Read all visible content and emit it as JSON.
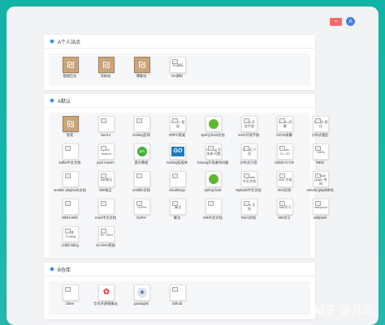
{
  "topbar": {
    "button_label": "▪",
    "avatar_letter": "A"
  },
  "sections": [
    {
      "title": "A个人站点",
      "items": [
        {
          "icon": "ru-icon",
          "label": "管理后台",
          "icon_text": ""
        },
        {
          "icon": "ru-icon",
          "label": "导航站",
          "icon_text": ""
        },
        {
          "icon": "ru-icon",
          "label": "博客站",
          "icon_text": ""
        },
        {
          "icon": "broken-image-icon",
          "label": "Go源码",
          "icon_text": "Go源码"
        }
      ]
    },
    {
      "title": "A默认",
      "items": [
        {
          "icon": "ru-icon",
          "label": "答案",
          "icon_text": ""
        },
        {
          "icon": "broken-image-icon",
          "label": "vue3.x",
          "icon_text": ""
        },
        {
          "icon": "broken-image-icon",
          "label": "Golang官网",
          "icon_text": ""
        },
        {
          "icon": "broken-image-icon",
          "label": "GRPC框架",
          "icon_text": "GRPC 框架"
        },
        {
          "icon": "spring-icon",
          "label": "spring boot文档",
          "icon_text": ""
        },
        {
          "icon": "broken-image-icon",
          "label": "JAVA开发手册",
          "icon_text": "JAVA 开发手册"
        },
        {
          "icon": "broken-image-icon",
          "label": "CI/CD讲解",
          "icon_text": "CI/CD 讲解"
        },
        {
          "icon": "broken-image-icon",
          "label": "分布式相比",
          "icon_text": "分布式 相比"
        },
        {
          "icon": "broken-image-icon",
          "label": "kafka中文文档",
          "icon_text": ""
        },
        {
          "icon": "broken-image-icon",
          "label": "java maven",
          "icon_text": "java maven"
        },
        {
          "icon": "cai-icon",
          "label": "菜鸟教程",
          "icon_text": "菜鸟"
        },
        {
          "icon": "go-icon",
          "label": "Golang标准库",
          "icon_text": "GO"
        },
        {
          "icon": "broken-image-icon",
          "label": "Golang开发者的问题",
          "icon_text": "Golang 开发者 问题"
        },
        {
          "icon": "broken-image-icon",
          "label": "分布式介绍",
          "icon_text": "分布式 介绍"
        },
        {
          "icon": "broken-image-icon",
          "label": "Gitlab-CI-CD",
          "icon_text": "Gitlab- CI- CD"
        },
        {
          "icon": "broken-image-icon",
          "label": "MDN",
          "icon_text": "MDN"
        },
        {
          "icon": "broken-image-icon",
          "label": "ansible playbook文档",
          "icon_text": ""
        },
        {
          "icon": "broken-image-icon",
          "label": "k8s笔记",
          "icon_text": "k8s笔记"
        },
        {
          "icon": "broken-image-icon",
          "label": "ansible文档",
          "icon_text": ""
        },
        {
          "icon": "broken-image-icon",
          "label": "cloudiesgo",
          "icon_text": ""
        },
        {
          "icon": "spring-icon",
          "label": "spring-boot",
          "icon_text": ""
        },
        {
          "icon": "broken-image-icon",
          "label": "Mybatis中文文档",
          "icon_text": "Mybatis 中文文档"
        },
        {
          "icon": "broken-image-icon",
          "label": "etcd文档",
          "icon_text": "etcd 文档"
        },
        {
          "icon": "broken-image-icon",
          "label": "nebula-graph库网",
          "icon_text": "nebula graph 库网"
        },
        {
          "icon": "broken-image-icon",
          "label": "MDN-Web",
          "icon_text": ""
        },
        {
          "icon": "broken-image-icon",
          "label": "react中文文档",
          "icon_text": ""
        },
        {
          "icon": "broken-image-icon",
          "label": "GoPer",
          "icon_text": "GoPer"
        },
        {
          "icon": "broken-image-icon",
          "label": "算法",
          "icon_text": "算法"
        },
        {
          "icon": "broken-image-icon",
          "label": "k8s中文文档",
          "icon_text": ""
        },
        {
          "icon": "broken-image-icon",
          "label": "Dumi文档",
          "icon_text": "Dumi 文档"
        },
        {
          "icon": "broken-image-icon",
          "label": "k8s学习",
          "icon_text": "k8s学习"
        },
        {
          "icon": "broken-image-icon",
          "label": "webpack",
          "icon_text": "webpack"
        },
        {
          "icon": "broken-image-icon",
          "label": "小林Coding",
          "icon_text": "小林 Coding"
        },
        {
          "icon": "broken-image-icon",
          "label": "Go-Zero框架",
          "icon_text": "Go- Zero"
        }
      ]
    },
    {
      "title": "B仓库",
      "items": [
        {
          "icon": "broken-image-icon",
          "label": "Gitee",
          "icon_text": ""
        },
        {
          "icon": "huawei-icon",
          "label": "华为开源镜像站",
          "icon_text": ""
        },
        {
          "icon": "package-icon",
          "label": "packagist",
          "icon_text": ""
        },
        {
          "icon": "broken-image-icon",
          "label": "Github",
          "icon_text": ""
        }
      ]
    }
  ],
  "watermark": "知乎 @凡之"
}
